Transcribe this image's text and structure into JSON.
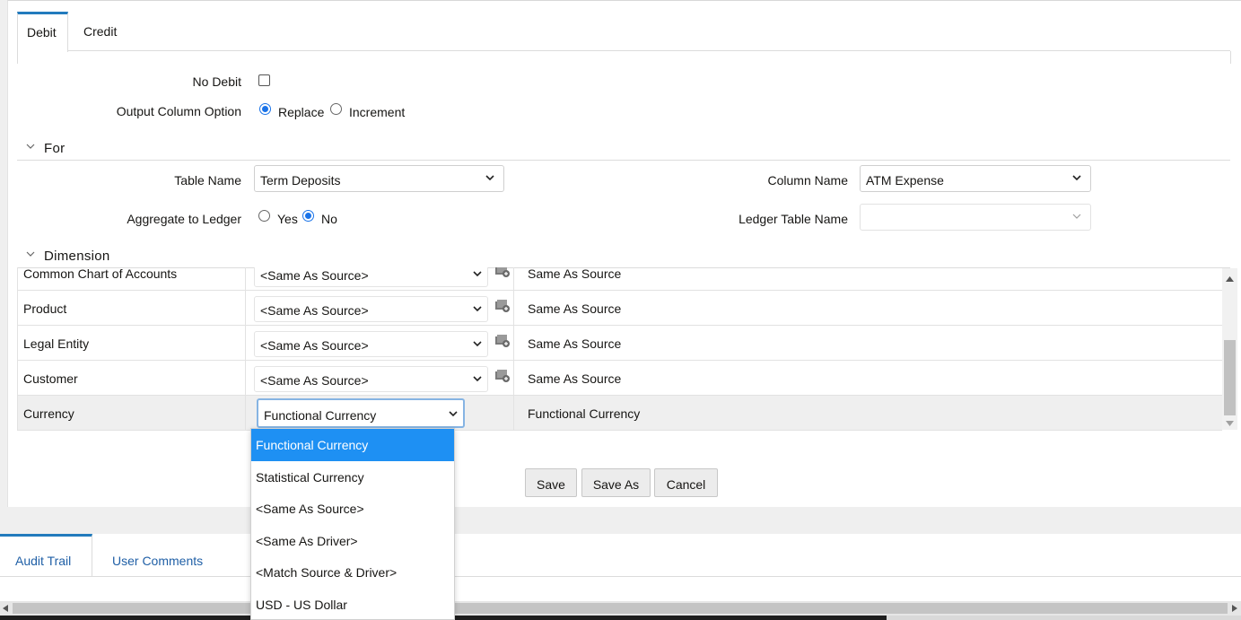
{
  "tabs": {
    "debit": "Debit",
    "credit": "Credit"
  },
  "form": {
    "no_debit_label": "No Debit",
    "output_column_option_label": "Output Column Option",
    "replace_label": "Replace",
    "increment_label": "Increment",
    "output_column_option_selected": "Replace"
  },
  "for_section": {
    "title": "For",
    "table_name_label": "Table Name",
    "table_name_value": "Term Deposits",
    "column_name_label": "Column Name",
    "column_name_value": "ATM Expense",
    "aggregate_label": "Aggregate to Ledger",
    "yes_label": "Yes",
    "no_label": "No",
    "aggregate_selected": "No",
    "ledger_table_label": "Ledger Table Name",
    "ledger_table_value": ""
  },
  "dimension": {
    "title": "Dimension",
    "rows": [
      {
        "name": "Common Chart of Accounts",
        "select": "<Same As Source>",
        "value": "Same As Source"
      },
      {
        "name": "Product",
        "select": "<Same As Source>",
        "value": "Same As Source"
      },
      {
        "name": "Legal Entity",
        "select": "<Same As Source>",
        "value": "Same As Source"
      },
      {
        "name": "Customer",
        "select": "<Same As Source>",
        "value": "Same As Source"
      },
      {
        "name": "Currency",
        "select": "Functional Currency",
        "value": "Functional Currency"
      }
    ]
  },
  "dropdown": {
    "options": [
      "Functional Currency",
      "Statistical Currency",
      "<Same As Source>",
      "<Same As Driver>",
      "<Match Source & Driver>",
      "USD - US Dollar"
    ],
    "highlighted": "Functional Currency"
  },
  "buttons": {
    "save": "Save",
    "save_as": "Save As",
    "cancel": "Cancel"
  },
  "bottom_tabs": {
    "audit_trail": "Audit Trail",
    "user_comments": "User Comments"
  },
  "colors": {
    "accent": "#227bbd",
    "highlight": "#1e90f3",
    "radio_on": "#1a73e8",
    "link": "#1f5fa6"
  }
}
